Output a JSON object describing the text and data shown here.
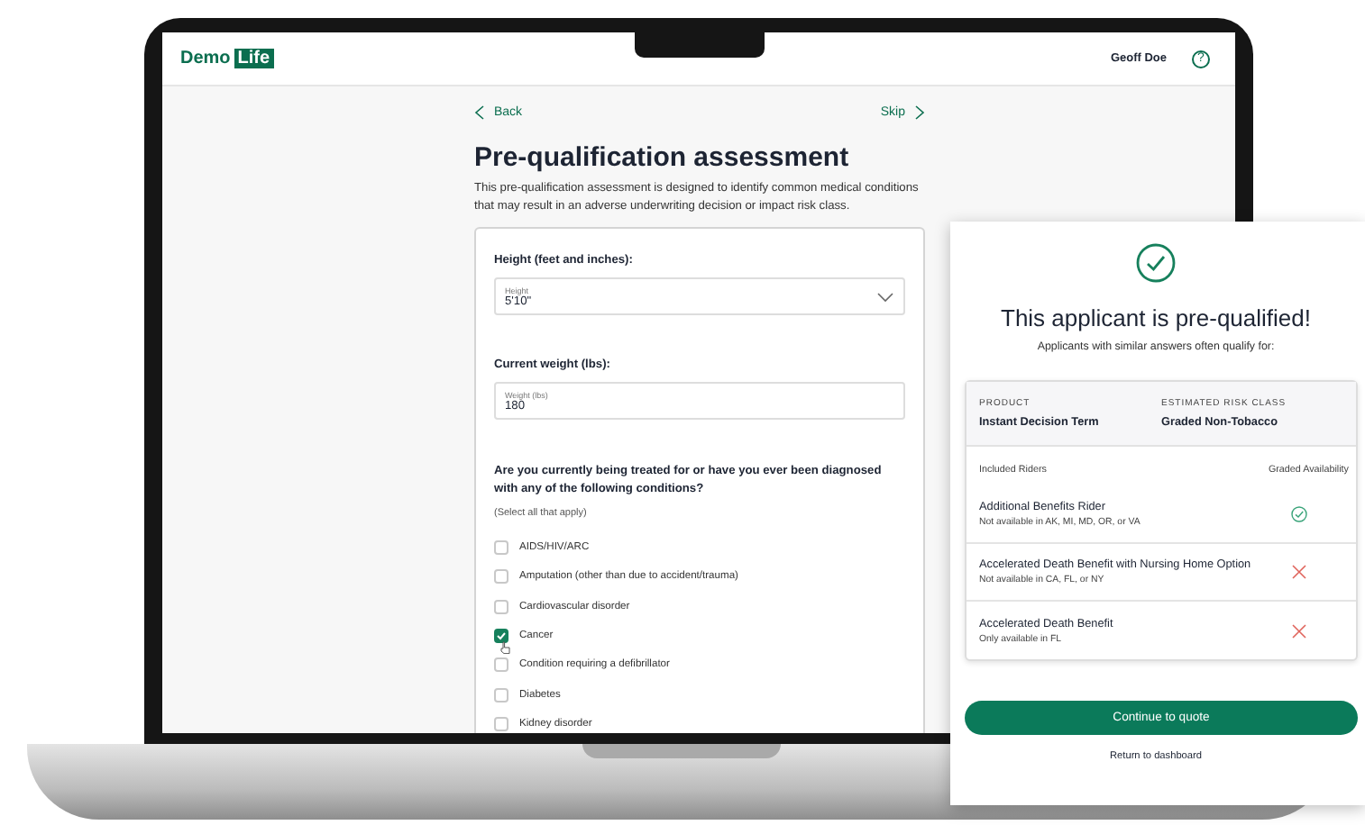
{
  "header": {
    "logo": {
      "first": "Demo",
      "second": "Life"
    },
    "user": "Geoff Doe",
    "help": "?"
  },
  "nav": {
    "back": "Back",
    "skip": "Skip"
  },
  "title": "Pre-qualification assessment",
  "description": "This pre-qualification assessment is designed to identify common medical conditions that may result in an adverse underwriting decision or impact risk class.",
  "form": {
    "height": {
      "label": "Height (feet and inches):",
      "field_label": "Height",
      "value": "5'10\""
    },
    "weight": {
      "label": "Current weight (lbs):",
      "field_label": "Weight (lbs)",
      "value": "180"
    },
    "conditions": {
      "question": "Are you currently being treated for or have you ever been diagnosed with any of the following conditions?",
      "hint": "(Select all that apply)",
      "options": [
        {
          "label": "AIDS/HIV/ARC",
          "checked": false
        },
        {
          "label": "Amputation (other than due to accident/trauma)",
          "checked": false
        },
        {
          "label": "Cardiovascular disorder",
          "checked": false
        },
        {
          "label": "Cancer",
          "checked": true
        },
        {
          "label": "Condition requiring a defibrillator",
          "checked": false
        },
        {
          "label": "Diabetes",
          "checked": false
        },
        {
          "label": "Kidney disorder",
          "checked": false
        }
      ]
    }
  },
  "result": {
    "title": "This applicant is pre-qualified!",
    "subtitle": "Applicants with similar answers often qualify for:",
    "product": {
      "label": "PRODUCT",
      "value": "Instant Decision Term"
    },
    "risk_class": {
      "label": "ESTIMATED RISK CLASS",
      "value": "Graded Non-Tobacco"
    },
    "riders_header": {
      "name": "Included Riders",
      "availability": "Graded Availability"
    },
    "riders": [
      {
        "name": "Additional Benefits Rider",
        "note": "Not available in AK, MI, MD, OR, or VA",
        "available": true
      },
      {
        "name": "Accelerated Death Benefit with Nursing Home Option",
        "note": "Not available in CA, FL, or NY",
        "available": false
      },
      {
        "name": "Accelerated Death Benefit",
        "note": "Only available in FL",
        "available": false
      }
    ],
    "primary_button": "Continue to quote",
    "link": "Return to dashboard"
  }
}
